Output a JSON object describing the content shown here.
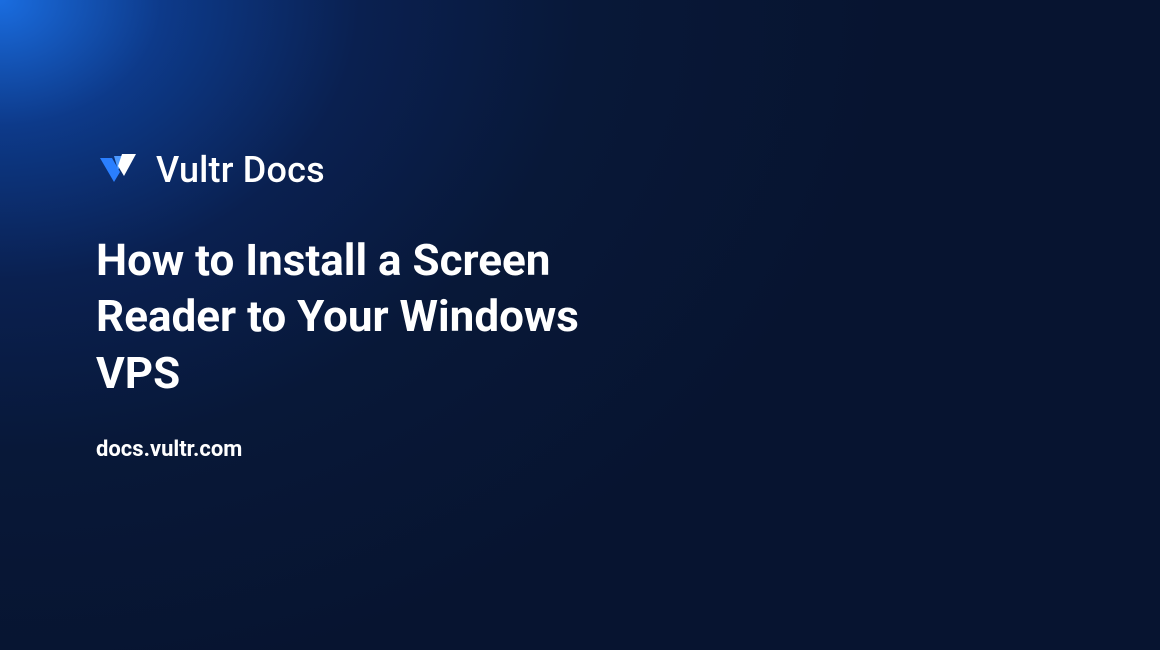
{
  "brand": {
    "name": "Vultr Docs",
    "icon": "vultr-logo"
  },
  "title": "How to Install a Screen Reader to Your Windows VPS",
  "domain": "docs.vultr.com"
}
